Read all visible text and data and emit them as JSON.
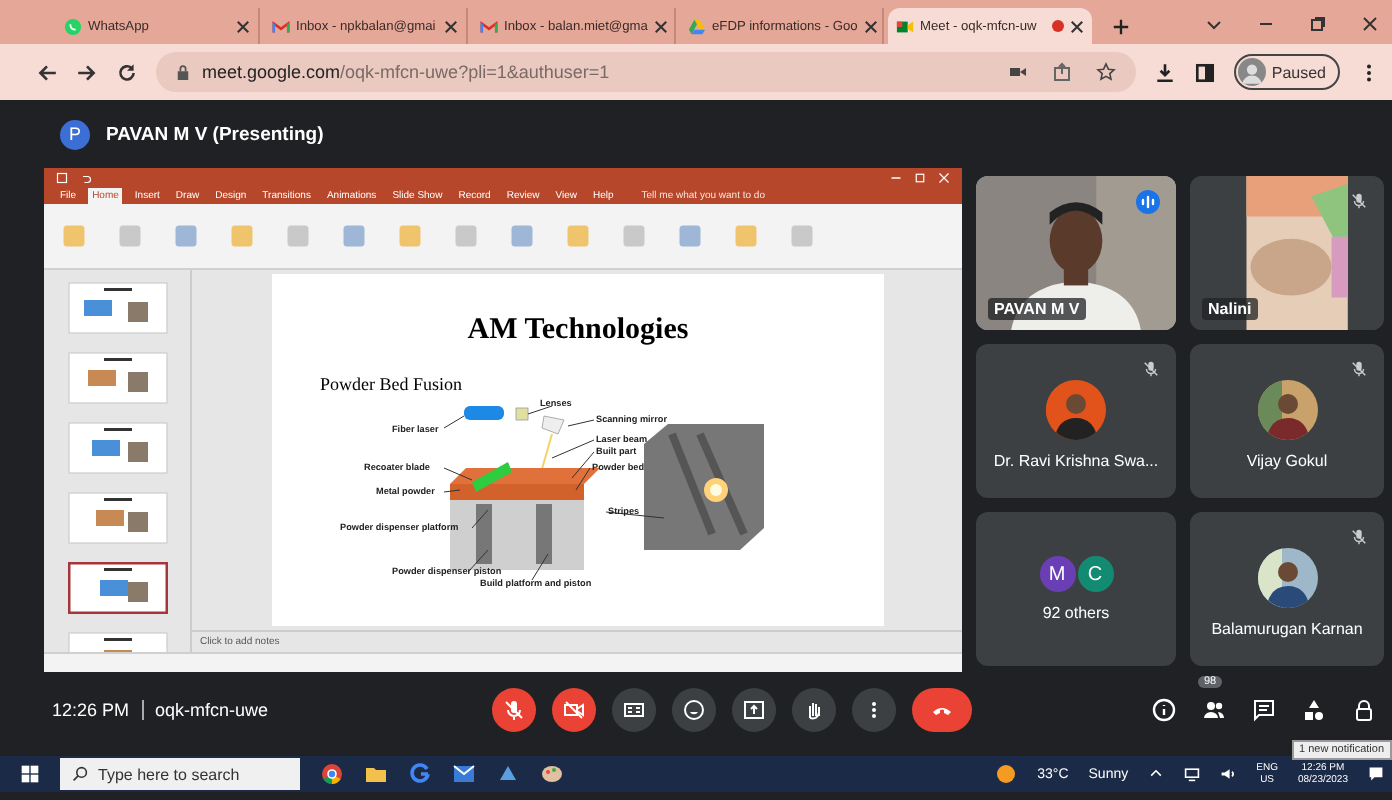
{
  "browser": {
    "tabs": [
      {
        "kind": "whatsapp",
        "title": "WhatsApp",
        "selected": false
      },
      {
        "kind": "gmail",
        "title": "Inbox - npkbalan@gmai",
        "selected": false
      },
      {
        "kind": "gmail",
        "title": "Inbox - balan.miet@gma",
        "selected": false
      },
      {
        "kind": "drive",
        "title": "eFDP informations - Goo",
        "selected": false
      },
      {
        "kind": "meet",
        "title": "Meet - oqk-mfcn-uw",
        "selected": true,
        "recording": true
      }
    ],
    "address": {
      "host": "meet.google.com",
      "path": "/oqk-mfcn-uwe?pli=1&authuser=1"
    },
    "profile_status": "Paused"
  },
  "meet": {
    "presenter_initial": "P",
    "presenter": "PAVAN M V (Presenting)",
    "powerpoint": {
      "tabs": [
        {
          "label": "File",
          "selected": false
        },
        {
          "label": "Home",
          "selected": true
        },
        {
          "label": "Insert",
          "selected": false
        },
        {
          "label": "Draw",
          "selected": false
        },
        {
          "label": "Design",
          "selected": false
        },
        {
          "label": "Transitions",
          "selected": false
        },
        {
          "label": "Animations",
          "selected": false
        },
        {
          "label": "Slide Show",
          "selected": false
        },
        {
          "label": "Record",
          "selected": false
        },
        {
          "label": "Review",
          "selected": false
        },
        {
          "label": "View",
          "selected": false
        },
        {
          "label": "Help",
          "selected": false
        }
      ],
      "tell_me": "Tell me what you want to do",
      "thumbnails": [
        {
          "selected": false
        },
        {
          "selected": false
        },
        {
          "selected": false
        },
        {
          "selected": false
        },
        {
          "selected": true
        },
        {
          "selected": false
        }
      ],
      "slide": {
        "title": "AM Technologies",
        "subtitle": "Powder Bed Fusion",
        "labels": [
          "Fiber laser",
          "Lenses",
          "Scanning mirror",
          "Laser beam",
          "Built part",
          "Powder bed",
          "Recoater blade",
          "Metal powder",
          "Powder dispenser platform",
          "Stripes",
          "Powder dispenser piston",
          "Build platform and piston"
        ]
      },
      "notes_placeholder": "Click to add notes"
    },
    "tiles": [
      {
        "kind": "video",
        "name": "PAVAN M V",
        "speaking": true,
        "muted": false
      },
      {
        "kind": "video",
        "name": "Nalini",
        "speaking": false,
        "muted": true
      },
      {
        "kind": "avatar",
        "name": "Dr. Ravi Krishna Swa...",
        "speaking": false,
        "muted": true
      },
      {
        "kind": "avatar",
        "name": "Vijay Gokul",
        "speaking": false,
        "muted": true
      },
      {
        "kind": "others",
        "initials": [
          "M",
          "C"
        ],
        "name": "92 others",
        "speaking": false,
        "muted": false
      },
      {
        "kind": "avatar",
        "name": "Balamurugan Karnan",
        "speaking": false,
        "muted": true
      }
    ],
    "time": "12:26 PM",
    "meeting_code": "oqk-mfcn-uwe",
    "controls": [
      {
        "kind": "mic",
        "off": true
      },
      {
        "kind": "camera",
        "off": true
      },
      {
        "kind": "captions",
        "off": false
      },
      {
        "kind": "emoji",
        "off": false
      },
      {
        "kind": "present",
        "off": false
      },
      {
        "kind": "hand",
        "off": false
      },
      {
        "kind": "more",
        "off": false
      },
      {
        "kind": "leave"
      }
    ],
    "people_count": "98",
    "notification_tooltip": "1 new notification"
  },
  "taskbar": {
    "search_placeholder": "Type here to search",
    "temperature": "33°C",
    "weather": "Sunny",
    "language": "ENG",
    "region": "US",
    "time": "12:26 PM",
    "date": "08/23/2023"
  }
}
